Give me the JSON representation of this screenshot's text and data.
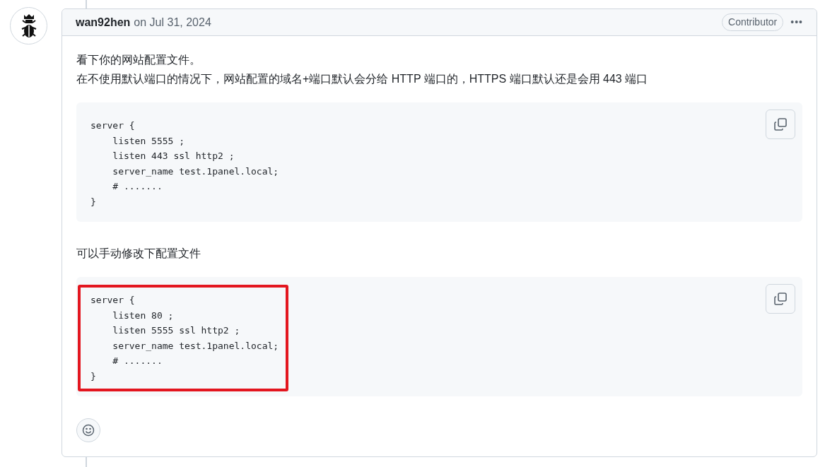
{
  "comment": {
    "author": "wan92hen",
    "date": "on Jul 31, 2024",
    "badge": "Contributor",
    "menu": "•••",
    "body": [
      {
        "kind": "text",
        "lines": [
          "看下你的网站配置文件。",
          "在不使用默认端口的情况下，网站配置的域名+端口默认会分给 HTTP 端口的，HTTPS 端口默认还是会用 443 端口"
        ]
      },
      {
        "kind": "code",
        "highlighted": false,
        "lines": [
          "server {",
          "    listen 5555 ;",
          "    listen 443 ssl http2 ;",
          "    server_name test.1panel.local;",
          "    # .......",
          "}"
        ]
      },
      {
        "kind": "text",
        "lines": [
          "可以手动修改下配置文件"
        ]
      },
      {
        "kind": "code",
        "highlighted": true,
        "lines": [
          "server {",
          "    listen 80 ;",
          "    listen 5555 ssl http2 ;",
          "    server_name test.1panel.local;",
          "    # .......",
          "}"
        ]
      }
    ]
  }
}
